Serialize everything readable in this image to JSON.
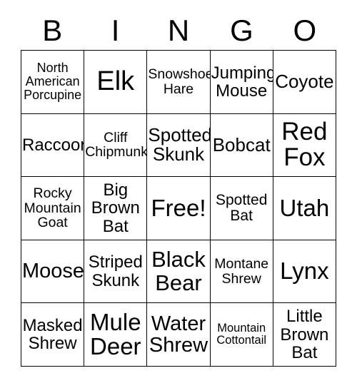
{
  "card": {
    "title": "BINGO",
    "free_space_label": "Free!",
    "grid_line_color": "#000000",
    "text_color": "#000000",
    "background_color": "#ffffff"
  },
  "header": {
    "letters": [
      "B",
      "I",
      "N",
      "G",
      "O"
    ]
  },
  "grid": {
    "columns": 5,
    "rows": 5,
    "cells": [
      {
        "text": "North American Porcupine",
        "size": "fs-18",
        "column": "B",
        "row": 1
      },
      {
        "text": "Elk",
        "size": "fs-38",
        "column": "I",
        "row": 1
      },
      {
        "text": "Snowshoe Hare",
        "size": "fs-19",
        "column": "N",
        "row": 1
      },
      {
        "text": "Jumping Mouse",
        "size": "fs-24",
        "column": "G",
        "row": 1
      },
      {
        "text": "Coyote",
        "size": "fs-26",
        "column": "O",
        "row": 1
      },
      {
        "text": "Raccoon",
        "size": "fs-24",
        "column": "B",
        "row": 2
      },
      {
        "text": "Cliff Chipmunk",
        "size": "fs-19",
        "column": "I",
        "row": 2
      },
      {
        "text": "Spotted Skunk",
        "size": "fs-26",
        "column": "N",
        "row": 2
      },
      {
        "text": "Bobcat",
        "size": "fs-26",
        "column": "G",
        "row": 2
      },
      {
        "text": "Red Fox",
        "size": "fs-35",
        "column": "O",
        "row": 2
      },
      {
        "text": "Rocky Mountain Goat",
        "size": "fs-19",
        "column": "B",
        "row": 3
      },
      {
        "text": "Big Brown Bat",
        "size": "fs-24",
        "column": "I",
        "row": 3
      },
      {
        "text": "Free!",
        "size": "fs-33",
        "column": "N",
        "row": 3
      },
      {
        "text": "Spotted Bat",
        "size": "fs-21",
        "column": "G",
        "row": 3
      },
      {
        "text": "Utah",
        "size": "fs-33",
        "column": "O",
        "row": 3
      },
      {
        "text": "Moose",
        "size": "fs-29",
        "column": "B",
        "row": 4
      },
      {
        "text": "Striped Skunk",
        "size": "fs-24",
        "column": "I",
        "row": 4
      },
      {
        "text": "Black Bear",
        "size": "fs-31",
        "column": "N",
        "row": 4
      },
      {
        "text": "Montane Shrew",
        "size": "fs-19",
        "column": "G",
        "row": 4
      },
      {
        "text": "Lynx",
        "size": "fs-33",
        "column": "O",
        "row": 4
      },
      {
        "text": "Masked Shrew",
        "size": "fs-24",
        "column": "B",
        "row": 5
      },
      {
        "text": "Mule Deer",
        "size": "fs-33",
        "column": "I",
        "row": 5
      },
      {
        "text": "Water Shrew",
        "size": "fs-29",
        "column": "N",
        "row": 5
      },
      {
        "text": "Mountain Cottontail",
        "size": "fs-16",
        "column": "G",
        "row": 5
      },
      {
        "text": "Little Brown Bat",
        "size": "fs-24",
        "column": "O",
        "row": 5
      }
    ]
  }
}
